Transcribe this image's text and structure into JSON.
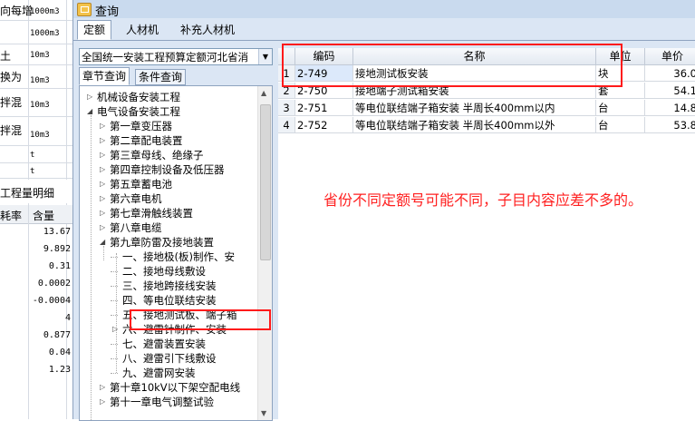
{
  "background": {
    "rows": [
      {
        "c1": "向每增",
        "c2": "1000m3"
      },
      {
        "c1": "",
        "c2": "1000m3"
      },
      {
        "c1": "土",
        "c2": "10m3"
      },
      {
        "c1": "换为",
        "c2": "10m3"
      },
      {
        "c1": "拌混",
        "c2": "10m3"
      },
      {
        "c1": "拌混",
        "c2": "10m3"
      },
      {
        "c1": "",
        "c2": "t"
      },
      {
        "c1": "",
        "c2": "t"
      }
    ],
    "tab_label": "工程量明细",
    "headers": {
      "rate": "耗率",
      "qty": "含量"
    },
    "values": [
      "13.67",
      "9.892",
      "0.31",
      "0.0002",
      "-0.0004",
      "4",
      "0.877",
      "0.04",
      "1.23"
    ]
  },
  "dialog": {
    "title": "查询",
    "tabs": [
      "定额",
      "人材机",
      "补充人材机"
    ]
  },
  "left_panel": {
    "combo_value": "全国统一安装工程预算定额河北省消",
    "subtabs": [
      "章节查询",
      "条件查询"
    ],
    "tree": {
      "nodes": [
        {
          "label": "机械设备安装工程",
          "state": "collapsed"
        },
        {
          "label": "电气设备安装工程",
          "state": "expanded"
        },
        {
          "label": "第一章变压器",
          "state": "collapsed"
        },
        {
          "label": "第二章配电装置",
          "state": "collapsed"
        },
        {
          "label": "第三章母线、绝缘子",
          "state": "collapsed"
        },
        {
          "label": "第四章控制设备及低压器",
          "state": "collapsed"
        },
        {
          "label": "第五章蓄电池",
          "state": "collapsed"
        },
        {
          "label": "第六章电机",
          "state": "collapsed"
        },
        {
          "label": "第七章滑触线装置",
          "state": "collapsed"
        },
        {
          "label": "第八章电缆",
          "state": "collapsed"
        },
        {
          "label": "第九章防雷及接地装置",
          "state": "expanded"
        },
        {
          "label": "一、接地极(板)制作、安",
          "state": "leaf"
        },
        {
          "label": "二、接地母线敷设",
          "state": "leaf"
        },
        {
          "label": "三、接地跨接线安装",
          "state": "leaf"
        },
        {
          "label": "四、等电位联结安装",
          "state": "leaf"
        },
        {
          "label": "五、接地测试板、端子箱",
          "state": "leaf-selected"
        },
        {
          "label": "六、避雷针制作、安装",
          "state": "collapsed"
        },
        {
          "label": "七、避雷装置安装",
          "state": "leaf"
        },
        {
          "label": "八、避雷引下线敷设",
          "state": "leaf"
        },
        {
          "label": "九、避雷网安装",
          "state": "leaf"
        },
        {
          "label": "第十章10kV以下架空配电线",
          "state": "collapsed"
        },
        {
          "label": "第十一章电气调整试验",
          "state": "collapsed"
        }
      ]
    }
  },
  "grid": {
    "columns": [
      "编码",
      "名称",
      "单位",
      "单价"
    ],
    "rows": [
      {
        "no": "1",
        "code": "2-749",
        "name": "接地测试板安装",
        "unit": "块",
        "price": "36.0"
      },
      {
        "no": "2",
        "code": "2-750",
        "name": "接地端子测试箱安装",
        "unit": "套",
        "price": "54.1"
      },
      {
        "no": "3",
        "code": "2-751",
        "name": "等电位联结端子箱安装 半周长400mm以内",
        "unit": "台",
        "price": "14.8"
      },
      {
        "no": "4",
        "code": "2-752",
        "name": "等电位联结端子箱安装 半周长400mm以外",
        "unit": "台",
        "price": "53.8"
      }
    ]
  },
  "annotation": {
    "text": "省份不同定额号可能不同，子目内容应差不多的。",
    "color": "#ff2020"
  }
}
